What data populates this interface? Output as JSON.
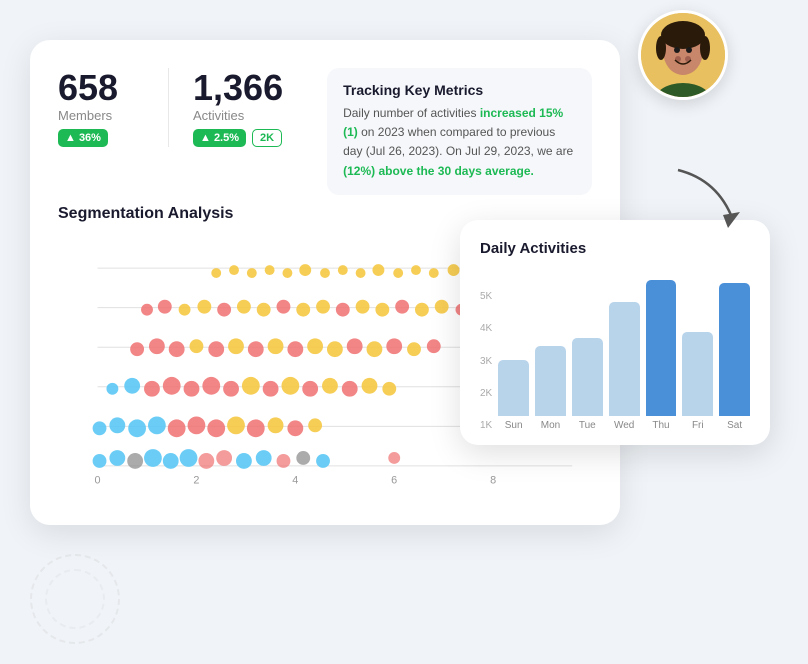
{
  "metrics": {
    "members": {
      "number": "658",
      "label": "Members",
      "badge": "▲ 36%"
    },
    "activities": {
      "number": "1,366",
      "label": "Activities",
      "badge": "▲ 2.5%",
      "badge2": "2K"
    }
  },
  "tracking": {
    "title": "Tracking Key Metrics",
    "text_parts": [
      "Daily number of activities ",
      "increased 15% (1)",
      " on 2023 when compared to previous day (Jul 26, 2023). On Jul 29, 2023, we are ",
      "(12%) above the 30 days average.",
      "."
    ],
    "full_text": "Daily number of activities increased 15% (1) on 2023 when compared to previous day (Jul 26, 2023). On Jul 29, 2023, we are (12%) above the 30 days average."
  },
  "segmentation": {
    "title": "Segmentation Analysis",
    "x_labels": [
      "0",
      "2",
      "4",
      "6",
      "8"
    ]
  },
  "daily": {
    "title": "Daily Activities",
    "y_labels": [
      "5K",
      "4K",
      "3K",
      "2K",
      "1K"
    ],
    "bars": [
      {
        "label": "Sun",
        "value": 2000,
        "max": 5000,
        "active": false
      },
      {
        "label": "Mon",
        "value": 2500,
        "max": 5000,
        "active": false
      },
      {
        "label": "Tue",
        "value": 2800,
        "max": 5000,
        "active": false
      },
      {
        "label": "Wed",
        "value": 4100,
        "max": 5000,
        "active": false
      },
      {
        "label": "Thu",
        "value": 4900,
        "max": 5000,
        "active": true
      },
      {
        "label": "Fri",
        "value": 3000,
        "max": 5000,
        "active": false
      },
      {
        "label": "Sat",
        "value": 4800,
        "max": 5000,
        "active": false
      }
    ]
  }
}
